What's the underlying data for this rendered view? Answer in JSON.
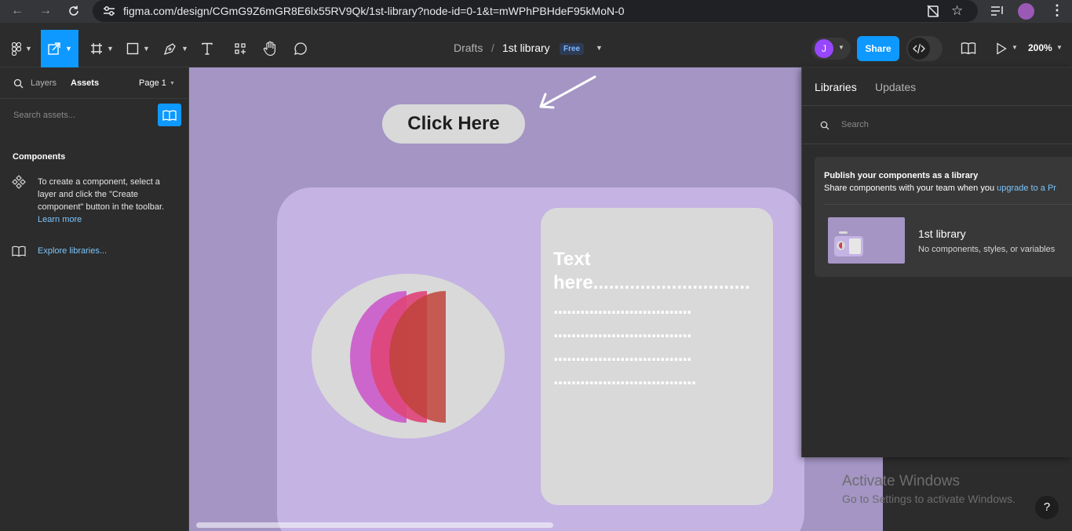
{
  "browser": {
    "url": "figma.com/design/CGmG9Z6mGR8E6lx55RV9Qk/1st-library?node-id=0-1&t=mWPhPBHdeF95kMoN-0"
  },
  "toolbar": {
    "breadcrumb_parent": "Drafts",
    "separator": "/",
    "file_name": "1st library",
    "plan_badge": "Free",
    "avatar_initial": "J",
    "share_label": "Share",
    "zoom": "200%"
  },
  "left_panel": {
    "tab_layers": "Layers",
    "tab_assets": "Assets",
    "page_selector": "Page 1",
    "search_placeholder": "Search assets...",
    "components_heading": "Components",
    "components_help_line1": "To create a component, select a",
    "components_help_line2": "layer and click the \"Create",
    "components_help_line3": "component\" button in the toolbar.",
    "learn_more": "Learn more",
    "explore_libraries": "Explore libraries..."
  },
  "canvas": {
    "button_label": "Click Here",
    "text_line1": "Text",
    "text_line2": "here..............................",
    "dots_line": "...............................",
    "dots_line_short": "................................"
  },
  "library_panel": {
    "tab_libraries": "Libraries",
    "tab_updates": "Updates",
    "search_placeholder": "Search",
    "publish_title": "Publish your components as a library",
    "publish_subtitle": "Share components with your team when you ",
    "upgrade_link": "upgrade to a Pr",
    "library_name": "1st library",
    "library_meta": "No components, styles, or variables"
  },
  "watermark": {
    "title": "Activate Windows",
    "subtitle": "Go to Settings to activate Windows."
  },
  "help_label": "?",
  "colors": {
    "accent": "#0d99ff",
    "canvas_bg": "#a495c5",
    "card_bg": "#c4b3e3",
    "panel_bg": "#2c2c2c"
  }
}
